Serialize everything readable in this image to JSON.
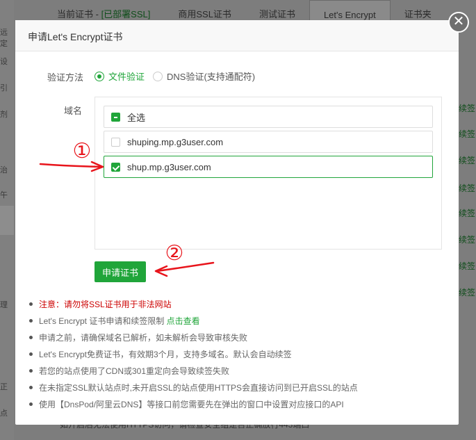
{
  "background": {
    "tabs": [
      {
        "prefix": "当前证书 - ",
        "status": "[已部署SSL]"
      },
      {
        "label": "商用SSL证书"
      },
      {
        "label": "测试证书"
      },
      {
        "label": "Let's Encrypt"
      },
      {
        "label": "证书夹"
      }
    ],
    "sidebar_fragments": [
      "远定",
      "设",
      "引",
      "剂",
      "治",
      "午",
      "理",
      "正",
      "点"
    ],
    "renew_label": "续签",
    "bottom_note": "如开启后无法使用HTTPS访问，请检查安全组是否正确放行443端口"
  },
  "modal": {
    "title": "申请Let's Encrypt证书",
    "close_glyph": "✕",
    "verify": {
      "label": "验证方法",
      "options": [
        {
          "label": "文件验证",
          "selected": true
        },
        {
          "label": "DNS验证(支持通配符)",
          "selected": false
        }
      ]
    },
    "domains": {
      "label": "域名",
      "select_all": "全选",
      "items": [
        {
          "name": "shuping.mp.g3user.com",
          "checked": false
        },
        {
          "name": "shup.mp.g3user.com",
          "checked": true
        }
      ]
    },
    "apply_button": "申请证书",
    "notes": {
      "warn": "注意：请勿将SSL证书用于非法网站",
      "limit_text": "Let's Encrypt 证书申请和续签限制 ",
      "limit_link": "点击查看",
      "items": [
        "申请之前，请确保域名已解析，如未解析会导致审核失败",
        "Let's Encrypt免费证书，有效期3个月，支持多域名。默认会自动续签",
        "若您的站点使用了CDN或301重定向会导致续签失败",
        "在未指定SSL默认站点时,未开启SSL的站点使用HTTPS会直接访问到已开启SSL的站点",
        "使用【DnsPod/阿里云DNS】等接口前您需要先在弹出的窗口中设置对应接口的API"
      ]
    }
  },
  "annotations": {
    "marker_1": "①",
    "marker_2": "②",
    "color": "#e8141b"
  },
  "colors": {
    "accent": "#20a53a",
    "warn": "#cc0000"
  }
}
